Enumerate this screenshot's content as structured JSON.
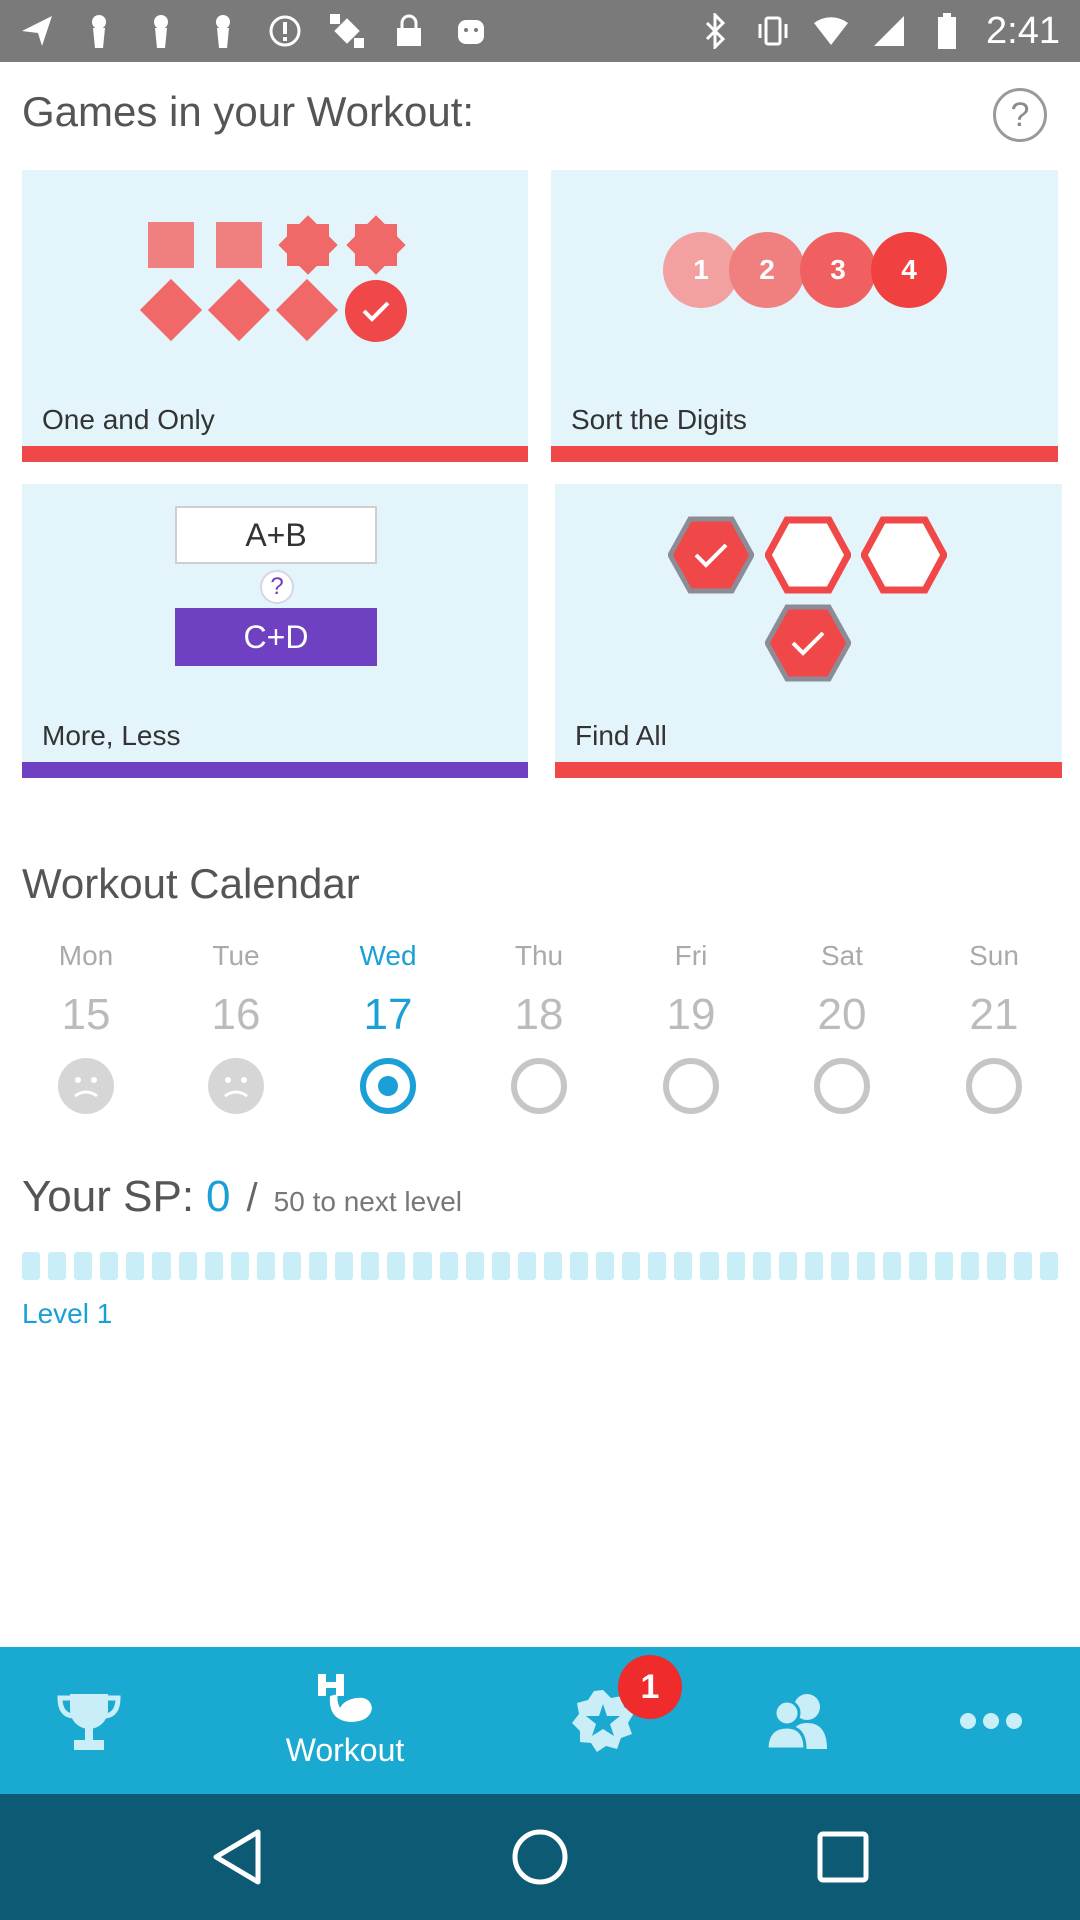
{
  "status_bar": {
    "time": "2:41",
    "left_icons": [
      "navigation-icon",
      "keyhole-icon",
      "keyhole-icon",
      "keyhole-icon",
      "alert-icon",
      "fake-gps-icon",
      "lock-icon",
      "android-icon"
    ],
    "right_icons": [
      "bluetooth-icon",
      "vibrate-icon",
      "wifi-icon",
      "signal-icon",
      "battery-icon"
    ]
  },
  "header": {
    "title": "Games in your Workout:",
    "help_label": "?"
  },
  "games": [
    {
      "label": "One and Only",
      "bar_color": "#f04848"
    },
    {
      "label": "Sort the Digits",
      "bar_color": "#f04848",
      "digits": [
        "1",
        "2",
        "3",
        "4"
      ]
    },
    {
      "label": "More, Less",
      "bar_color": "#6f40c2",
      "top_expr": "A+B",
      "question": "?",
      "bottom_expr": "C+D"
    },
    {
      "label": "Find All",
      "bar_color": "#f04848"
    }
  ],
  "calendar": {
    "title": "Workout Calendar",
    "days": [
      {
        "name": "Mon",
        "date": "15",
        "status": "missed"
      },
      {
        "name": "Tue",
        "date": "16",
        "status": "missed"
      },
      {
        "name": "Wed",
        "date": "17",
        "status": "current"
      },
      {
        "name": "Thu",
        "date": "18",
        "status": "upcoming"
      },
      {
        "name": "Fri",
        "date": "19",
        "status": "upcoming"
      },
      {
        "name": "Sat",
        "date": "20",
        "status": "upcoming"
      },
      {
        "name": "Sun",
        "date": "21",
        "status": "upcoming"
      }
    ]
  },
  "sp": {
    "label": "Your SP:",
    "value": "0",
    "separator": "/",
    "next": "50 to next level",
    "progress": 0,
    "level": "Level 1"
  },
  "bottom_nav": {
    "items": [
      {
        "icon": "trophy-icon",
        "label": ""
      },
      {
        "icon": "dumbbell-arm-icon",
        "label": "Workout"
      },
      {
        "icon": "star-badge-icon",
        "label": "",
        "badge": "1"
      },
      {
        "icon": "friends-icon",
        "label": ""
      },
      {
        "icon": "more-icon",
        "label": ""
      }
    ],
    "active": "Workout"
  },
  "colors": {
    "accent": "#1a9fd6",
    "nav_bg": "#1aa9d1",
    "game_red": "#f04848",
    "game_purple": "#6f40c2",
    "card_bg": "#e3f4fb"
  }
}
